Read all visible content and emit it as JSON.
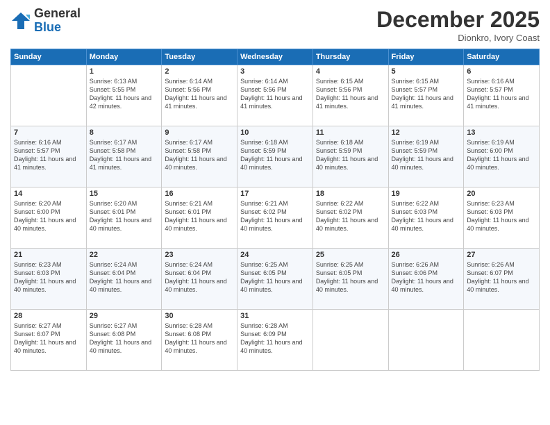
{
  "header": {
    "logo_line1": "General",
    "logo_line2": "Blue",
    "month": "December 2025",
    "location": "Dionkro, Ivory Coast"
  },
  "weekdays": [
    "Sunday",
    "Monday",
    "Tuesday",
    "Wednesday",
    "Thursday",
    "Friday",
    "Saturday"
  ],
  "weeks": [
    [
      {
        "day": "",
        "sunrise": "",
        "sunset": "",
        "daylight": ""
      },
      {
        "day": "1",
        "sunrise": "Sunrise: 6:13 AM",
        "sunset": "Sunset: 5:55 PM",
        "daylight": "Daylight: 11 hours and 42 minutes."
      },
      {
        "day": "2",
        "sunrise": "Sunrise: 6:14 AM",
        "sunset": "Sunset: 5:56 PM",
        "daylight": "Daylight: 11 hours and 41 minutes."
      },
      {
        "day": "3",
        "sunrise": "Sunrise: 6:14 AM",
        "sunset": "Sunset: 5:56 PM",
        "daylight": "Daylight: 11 hours and 41 minutes."
      },
      {
        "day": "4",
        "sunrise": "Sunrise: 6:15 AM",
        "sunset": "Sunset: 5:56 PM",
        "daylight": "Daylight: 11 hours and 41 minutes."
      },
      {
        "day": "5",
        "sunrise": "Sunrise: 6:15 AM",
        "sunset": "Sunset: 5:57 PM",
        "daylight": "Daylight: 11 hours and 41 minutes."
      },
      {
        "day": "6",
        "sunrise": "Sunrise: 6:16 AM",
        "sunset": "Sunset: 5:57 PM",
        "daylight": "Daylight: 11 hours and 41 minutes."
      }
    ],
    [
      {
        "day": "7",
        "sunrise": "Sunrise: 6:16 AM",
        "sunset": "Sunset: 5:57 PM",
        "daylight": "Daylight: 11 hours and 41 minutes."
      },
      {
        "day": "8",
        "sunrise": "Sunrise: 6:17 AM",
        "sunset": "Sunset: 5:58 PM",
        "daylight": "Daylight: 11 hours and 41 minutes."
      },
      {
        "day": "9",
        "sunrise": "Sunrise: 6:17 AM",
        "sunset": "Sunset: 5:58 PM",
        "daylight": "Daylight: 11 hours and 40 minutes."
      },
      {
        "day": "10",
        "sunrise": "Sunrise: 6:18 AM",
        "sunset": "Sunset: 5:59 PM",
        "daylight": "Daylight: 11 hours and 40 minutes."
      },
      {
        "day": "11",
        "sunrise": "Sunrise: 6:18 AM",
        "sunset": "Sunset: 5:59 PM",
        "daylight": "Daylight: 11 hours and 40 minutes."
      },
      {
        "day": "12",
        "sunrise": "Sunrise: 6:19 AM",
        "sunset": "Sunset: 5:59 PM",
        "daylight": "Daylight: 11 hours and 40 minutes."
      },
      {
        "day": "13",
        "sunrise": "Sunrise: 6:19 AM",
        "sunset": "Sunset: 6:00 PM",
        "daylight": "Daylight: 11 hours and 40 minutes."
      }
    ],
    [
      {
        "day": "14",
        "sunrise": "Sunrise: 6:20 AM",
        "sunset": "Sunset: 6:00 PM",
        "daylight": "Daylight: 11 hours and 40 minutes."
      },
      {
        "day": "15",
        "sunrise": "Sunrise: 6:20 AM",
        "sunset": "Sunset: 6:01 PM",
        "daylight": "Daylight: 11 hours and 40 minutes."
      },
      {
        "day": "16",
        "sunrise": "Sunrise: 6:21 AM",
        "sunset": "Sunset: 6:01 PM",
        "daylight": "Daylight: 11 hours and 40 minutes."
      },
      {
        "day": "17",
        "sunrise": "Sunrise: 6:21 AM",
        "sunset": "Sunset: 6:02 PM",
        "daylight": "Daylight: 11 hours and 40 minutes."
      },
      {
        "day": "18",
        "sunrise": "Sunrise: 6:22 AM",
        "sunset": "Sunset: 6:02 PM",
        "daylight": "Daylight: 11 hours and 40 minutes."
      },
      {
        "day": "19",
        "sunrise": "Sunrise: 6:22 AM",
        "sunset": "Sunset: 6:03 PM",
        "daylight": "Daylight: 11 hours and 40 minutes."
      },
      {
        "day": "20",
        "sunrise": "Sunrise: 6:23 AM",
        "sunset": "Sunset: 6:03 PM",
        "daylight": "Daylight: 11 hours and 40 minutes."
      }
    ],
    [
      {
        "day": "21",
        "sunrise": "Sunrise: 6:23 AM",
        "sunset": "Sunset: 6:03 PM",
        "daylight": "Daylight: 11 hours and 40 minutes."
      },
      {
        "day": "22",
        "sunrise": "Sunrise: 6:24 AM",
        "sunset": "Sunset: 6:04 PM",
        "daylight": "Daylight: 11 hours and 40 minutes."
      },
      {
        "day": "23",
        "sunrise": "Sunrise: 6:24 AM",
        "sunset": "Sunset: 6:04 PM",
        "daylight": "Daylight: 11 hours and 40 minutes."
      },
      {
        "day": "24",
        "sunrise": "Sunrise: 6:25 AM",
        "sunset": "Sunset: 6:05 PM",
        "daylight": "Daylight: 11 hours and 40 minutes."
      },
      {
        "day": "25",
        "sunrise": "Sunrise: 6:25 AM",
        "sunset": "Sunset: 6:05 PM",
        "daylight": "Daylight: 11 hours and 40 minutes."
      },
      {
        "day": "26",
        "sunrise": "Sunrise: 6:26 AM",
        "sunset": "Sunset: 6:06 PM",
        "daylight": "Daylight: 11 hours and 40 minutes."
      },
      {
        "day": "27",
        "sunrise": "Sunrise: 6:26 AM",
        "sunset": "Sunset: 6:07 PM",
        "daylight": "Daylight: 11 hours and 40 minutes."
      }
    ],
    [
      {
        "day": "28",
        "sunrise": "Sunrise: 6:27 AM",
        "sunset": "Sunset: 6:07 PM",
        "daylight": "Daylight: 11 hours and 40 minutes."
      },
      {
        "day": "29",
        "sunrise": "Sunrise: 6:27 AM",
        "sunset": "Sunset: 6:08 PM",
        "daylight": "Daylight: 11 hours and 40 minutes."
      },
      {
        "day": "30",
        "sunrise": "Sunrise: 6:28 AM",
        "sunset": "Sunset: 6:08 PM",
        "daylight": "Daylight: 11 hours and 40 minutes."
      },
      {
        "day": "31",
        "sunrise": "Sunrise: 6:28 AM",
        "sunset": "Sunset: 6:09 PM",
        "daylight": "Daylight: 11 hours and 40 minutes."
      },
      {
        "day": "",
        "sunrise": "",
        "sunset": "",
        "daylight": ""
      },
      {
        "day": "",
        "sunrise": "",
        "sunset": "",
        "daylight": ""
      },
      {
        "day": "",
        "sunrise": "",
        "sunset": "",
        "daylight": ""
      }
    ]
  ]
}
